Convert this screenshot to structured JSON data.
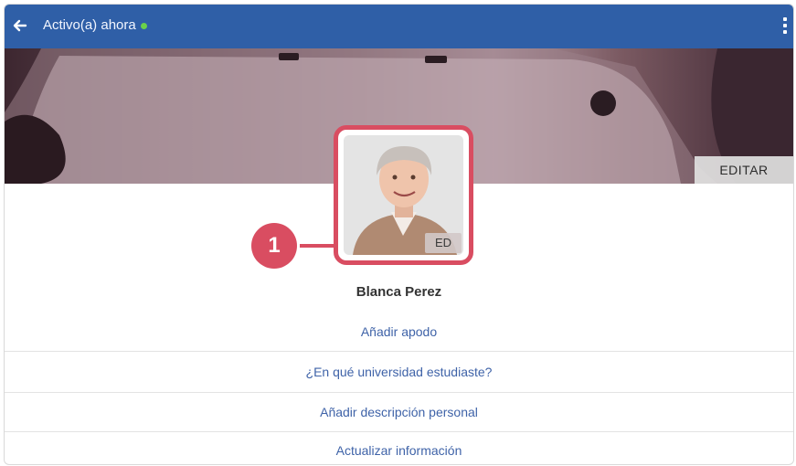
{
  "header": {
    "back_icon": "arrow-left-icon",
    "status_text": "Activo(a) ahora",
    "status_dot_color": "#6ad04a",
    "menu_icon": "more-vertical-icon"
  },
  "cover": {
    "edit_label": "EDITAR"
  },
  "avatar": {
    "badge_label": "ED"
  },
  "callout": {
    "number": "1",
    "color": "#d94d61"
  },
  "profile": {
    "name": "Blanca Perez"
  },
  "actions": [
    {
      "label": "Añadir apodo"
    },
    {
      "label": "¿En qué universidad estudiaste?"
    },
    {
      "label": "Añadir descripción personal"
    },
    {
      "label": "Actualizar información"
    }
  ],
  "colors": {
    "topbar": "#2f5fa7",
    "link": "#3f63a8"
  }
}
